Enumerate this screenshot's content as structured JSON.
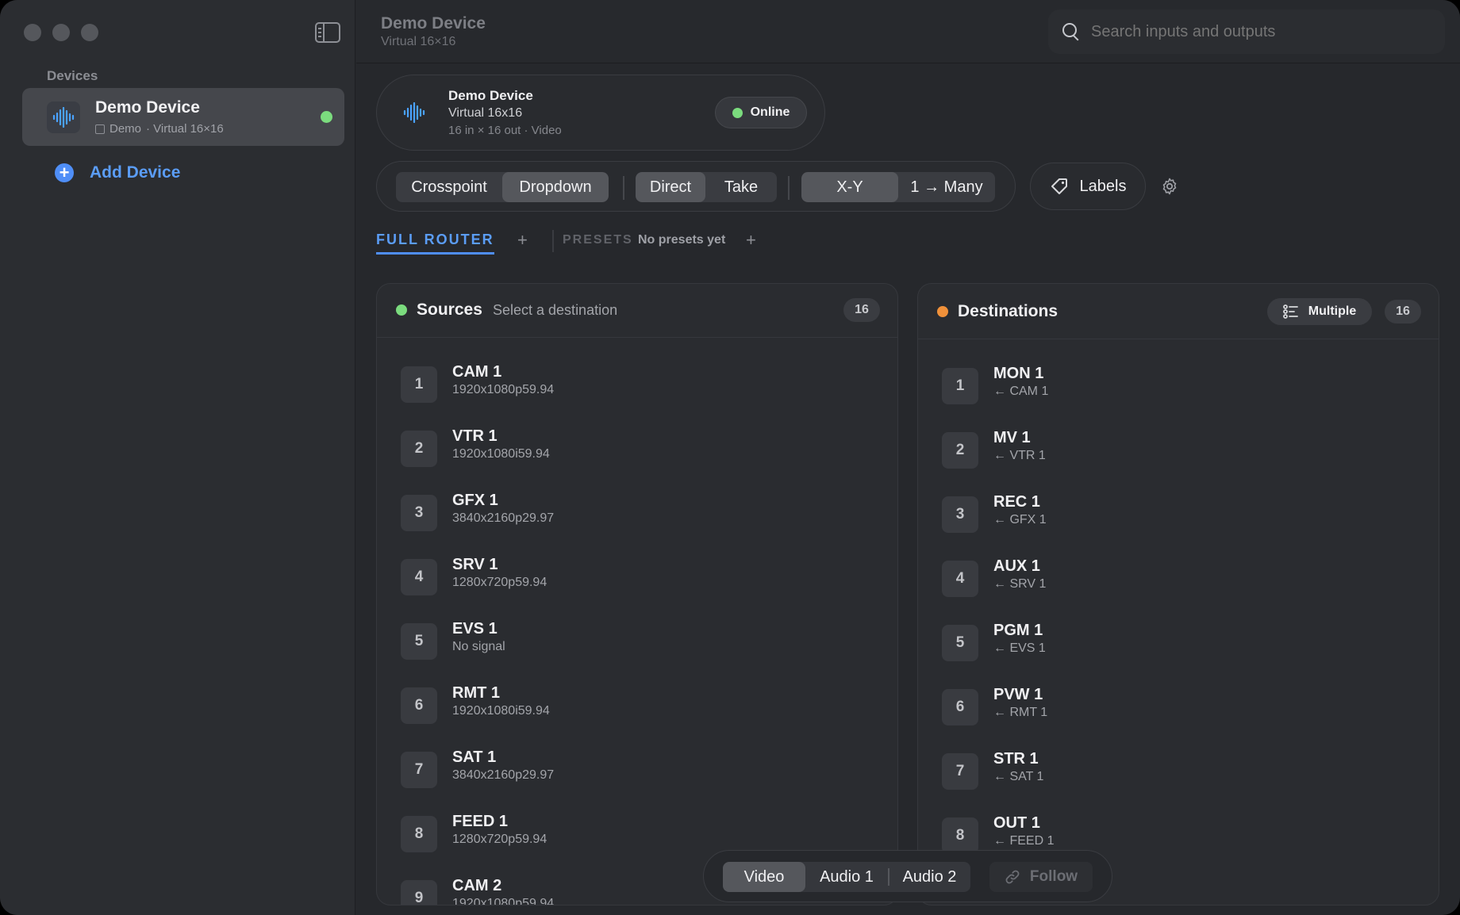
{
  "sidebar": {
    "heading": "Devices",
    "device": {
      "name": "Demo Device",
      "tag": "Demo",
      "type": "· Virtual 16×16",
      "status_color": "#7bdc7e"
    },
    "add_device": "Add Device"
  },
  "header": {
    "title": "Demo Device",
    "subtitle": "Virtual 16×16",
    "search_placeholder": "Search inputs and outputs"
  },
  "device_card": {
    "name": "Demo Device",
    "type": "Virtual 16x16",
    "meta": "16 in × 16 out · Video",
    "status": "Online"
  },
  "toolbar": {
    "view_modes": [
      "Crosspoint",
      "Dropdown"
    ],
    "take_modes": [
      "Direct",
      "Take"
    ],
    "route_modes": [
      "X-Y",
      "1 → Many"
    ],
    "labels": "Labels"
  },
  "tabs": {
    "full_router": "FULL ROUTER",
    "presets_label": "PRESETS",
    "presets_empty": "No presets yet"
  },
  "sources": {
    "title": "Sources",
    "hint": "Select a destination",
    "count": "16",
    "items": [
      {
        "num": "1",
        "name": "CAM 1",
        "format": "1920x1080p59.94"
      },
      {
        "num": "2",
        "name": "VTR 1",
        "format": "1920x1080i59.94"
      },
      {
        "num": "3",
        "name": "GFX 1",
        "format": "3840x2160p29.97"
      },
      {
        "num": "4",
        "name": "SRV 1",
        "format": "1280x720p59.94"
      },
      {
        "num": "5",
        "name": "EVS 1",
        "format": "No signal"
      },
      {
        "num": "6",
        "name": "RMT 1",
        "format": "1920x1080i59.94"
      },
      {
        "num": "7",
        "name": "SAT 1",
        "format": "3840x2160p29.97"
      },
      {
        "num": "8",
        "name": "FEED 1",
        "format": "1280x720p59.94"
      },
      {
        "num": "9",
        "name": "CAM 2",
        "format": "1920x1080p59.94"
      }
    ]
  },
  "destinations": {
    "title": "Destinations",
    "multiple": "Multiple",
    "count": "16",
    "items": [
      {
        "num": "1",
        "name": "MON 1",
        "source": "← CAM 1"
      },
      {
        "num": "2",
        "name": "MV 1",
        "source": "← VTR 1"
      },
      {
        "num": "3",
        "name": "REC 1",
        "source": "← GFX 1"
      },
      {
        "num": "4",
        "name": "AUX 1",
        "source": "← SRV 1"
      },
      {
        "num": "5",
        "name": "PGM 1",
        "source": "← EVS 1"
      },
      {
        "num": "6",
        "name": "PVW 1",
        "source": "← RMT 1"
      },
      {
        "num": "7",
        "name": "STR 1",
        "source": "← SAT 1"
      },
      {
        "num": "8",
        "name": "OUT 1",
        "source": "← FEED 1"
      }
    ]
  },
  "levels": {
    "items": [
      "Video",
      "Audio 1",
      "Audio 2"
    ],
    "follow": "Follow"
  },
  "colors": {
    "accent": "#4f8ef7",
    "online": "#7bdc7e",
    "destinations_dot": "#f0913a"
  }
}
